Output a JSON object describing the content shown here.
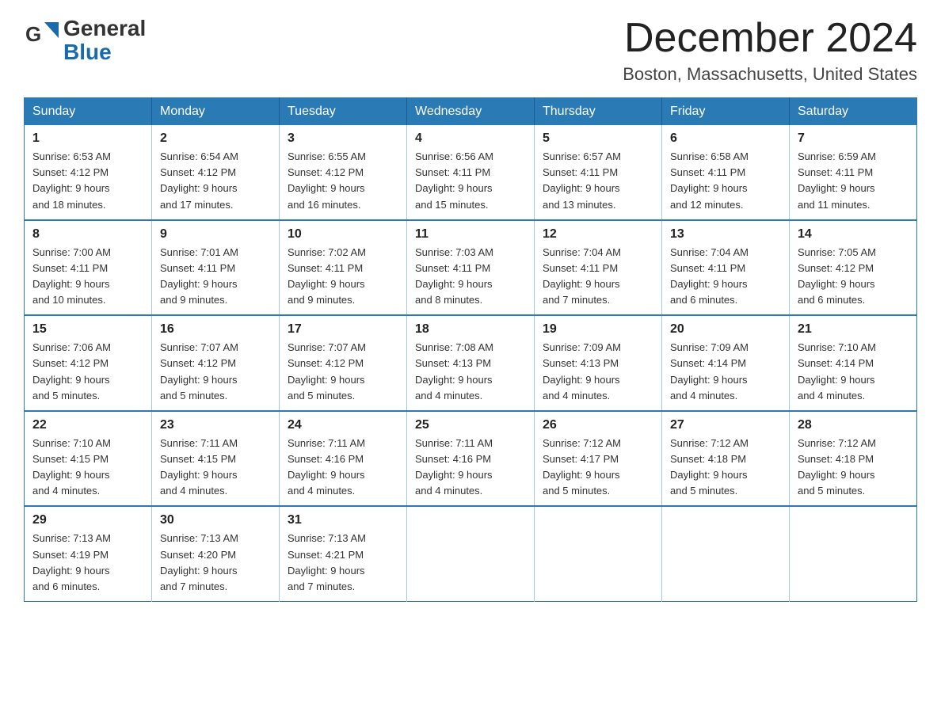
{
  "header": {
    "logo_general": "General",
    "logo_blue": "Blue",
    "month_title": "December 2024",
    "location": "Boston, Massachusetts, United States"
  },
  "days_of_week": [
    "Sunday",
    "Monday",
    "Tuesday",
    "Wednesday",
    "Thursday",
    "Friday",
    "Saturday"
  ],
  "weeks": [
    [
      {
        "day": "1",
        "sunrise": "6:53 AM",
        "sunset": "4:12 PM",
        "daylight": "9 hours and 18 minutes."
      },
      {
        "day": "2",
        "sunrise": "6:54 AM",
        "sunset": "4:12 PM",
        "daylight": "9 hours and 17 minutes."
      },
      {
        "day": "3",
        "sunrise": "6:55 AM",
        "sunset": "4:12 PM",
        "daylight": "9 hours and 16 minutes."
      },
      {
        "day": "4",
        "sunrise": "6:56 AM",
        "sunset": "4:11 PM",
        "daylight": "9 hours and 15 minutes."
      },
      {
        "day": "5",
        "sunrise": "6:57 AM",
        "sunset": "4:11 PM",
        "daylight": "9 hours and 13 minutes."
      },
      {
        "day": "6",
        "sunrise": "6:58 AM",
        "sunset": "4:11 PM",
        "daylight": "9 hours and 12 minutes."
      },
      {
        "day": "7",
        "sunrise": "6:59 AM",
        "sunset": "4:11 PM",
        "daylight": "9 hours and 11 minutes."
      }
    ],
    [
      {
        "day": "8",
        "sunrise": "7:00 AM",
        "sunset": "4:11 PM",
        "daylight": "9 hours and 10 minutes."
      },
      {
        "day": "9",
        "sunrise": "7:01 AM",
        "sunset": "4:11 PM",
        "daylight": "9 hours and 9 minutes."
      },
      {
        "day": "10",
        "sunrise": "7:02 AM",
        "sunset": "4:11 PM",
        "daylight": "9 hours and 9 minutes."
      },
      {
        "day": "11",
        "sunrise": "7:03 AM",
        "sunset": "4:11 PM",
        "daylight": "9 hours and 8 minutes."
      },
      {
        "day": "12",
        "sunrise": "7:04 AM",
        "sunset": "4:11 PM",
        "daylight": "9 hours and 7 minutes."
      },
      {
        "day": "13",
        "sunrise": "7:04 AM",
        "sunset": "4:11 PM",
        "daylight": "9 hours and 6 minutes."
      },
      {
        "day": "14",
        "sunrise": "7:05 AM",
        "sunset": "4:12 PM",
        "daylight": "9 hours and 6 minutes."
      }
    ],
    [
      {
        "day": "15",
        "sunrise": "7:06 AM",
        "sunset": "4:12 PM",
        "daylight": "9 hours and 5 minutes."
      },
      {
        "day": "16",
        "sunrise": "7:07 AM",
        "sunset": "4:12 PM",
        "daylight": "9 hours and 5 minutes."
      },
      {
        "day": "17",
        "sunrise": "7:07 AM",
        "sunset": "4:12 PM",
        "daylight": "9 hours and 5 minutes."
      },
      {
        "day": "18",
        "sunrise": "7:08 AM",
        "sunset": "4:13 PM",
        "daylight": "9 hours and 4 minutes."
      },
      {
        "day": "19",
        "sunrise": "7:09 AM",
        "sunset": "4:13 PM",
        "daylight": "9 hours and 4 minutes."
      },
      {
        "day": "20",
        "sunrise": "7:09 AM",
        "sunset": "4:14 PM",
        "daylight": "9 hours and 4 minutes."
      },
      {
        "day": "21",
        "sunrise": "7:10 AM",
        "sunset": "4:14 PM",
        "daylight": "9 hours and 4 minutes."
      }
    ],
    [
      {
        "day": "22",
        "sunrise": "7:10 AM",
        "sunset": "4:15 PM",
        "daylight": "9 hours and 4 minutes."
      },
      {
        "day": "23",
        "sunrise": "7:11 AM",
        "sunset": "4:15 PM",
        "daylight": "9 hours and 4 minutes."
      },
      {
        "day": "24",
        "sunrise": "7:11 AM",
        "sunset": "4:16 PM",
        "daylight": "9 hours and 4 minutes."
      },
      {
        "day": "25",
        "sunrise": "7:11 AM",
        "sunset": "4:16 PM",
        "daylight": "9 hours and 4 minutes."
      },
      {
        "day": "26",
        "sunrise": "7:12 AM",
        "sunset": "4:17 PM",
        "daylight": "9 hours and 5 minutes."
      },
      {
        "day": "27",
        "sunrise": "7:12 AM",
        "sunset": "4:18 PM",
        "daylight": "9 hours and 5 minutes."
      },
      {
        "day": "28",
        "sunrise": "7:12 AM",
        "sunset": "4:18 PM",
        "daylight": "9 hours and 5 minutes."
      }
    ],
    [
      {
        "day": "29",
        "sunrise": "7:13 AM",
        "sunset": "4:19 PM",
        "daylight": "9 hours and 6 minutes."
      },
      {
        "day": "30",
        "sunrise": "7:13 AM",
        "sunset": "4:20 PM",
        "daylight": "9 hours and 7 minutes."
      },
      {
        "day": "31",
        "sunrise": "7:13 AM",
        "sunset": "4:21 PM",
        "daylight": "9 hours and 7 minutes."
      },
      null,
      null,
      null,
      null
    ]
  ],
  "labels": {
    "sunrise": "Sunrise:",
    "sunset": "Sunset:",
    "daylight": "Daylight:"
  }
}
